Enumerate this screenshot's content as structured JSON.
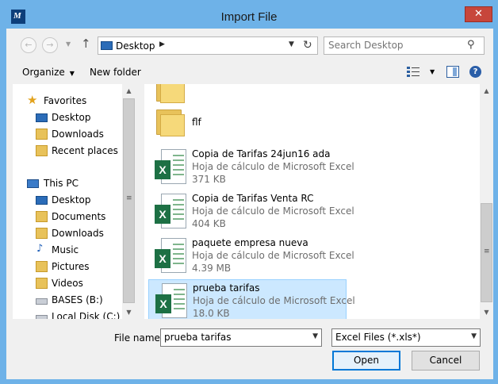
{
  "window": {
    "title": "Import File",
    "close_glyph": "✕",
    "icon": "dynamics-app-icon"
  },
  "address_bar": {
    "location": "Desktop"
  },
  "search": {
    "placeholder": "Search Desktop"
  },
  "toolbar": {
    "organize_label": "Organize",
    "new_folder_label": "New folder"
  },
  "nav_pane": {
    "favorites_header": "Favorites",
    "favorites": [
      {
        "label": "Desktop",
        "icon": "desktop-icon"
      },
      {
        "label": "Downloads",
        "icon": "downloads-folder-icon"
      },
      {
        "label": "Recent places",
        "icon": "recent-places-icon"
      }
    ],
    "this_pc_header": "This PC",
    "this_pc": [
      {
        "label": "Desktop",
        "icon": "desktop-icon"
      },
      {
        "label": "Documents",
        "icon": "documents-folder-icon"
      },
      {
        "label": "Downloads",
        "icon": "downloads-folder-icon"
      },
      {
        "label": "Music",
        "icon": "music-icon"
      },
      {
        "label": "Pictures",
        "icon": "pictures-folder-icon"
      },
      {
        "label": "Videos",
        "icon": "videos-folder-icon"
      },
      {
        "label": "BASES (B:)",
        "icon": "drive-icon"
      },
      {
        "label": "Local Disk (C:)",
        "icon": "drive-icon"
      }
    ]
  },
  "files": [
    {
      "name": "flf",
      "kind": "folder"
    },
    {
      "name": "Copia de Tarifas 24jun16 ada",
      "type": "Hoja de cálculo de Microsoft Excel",
      "size": "371 KB",
      "kind": "excel"
    },
    {
      "name": "Copia de Tarifas Venta RC",
      "type": "Hoja de cálculo de Microsoft Excel",
      "size": "404 KB",
      "kind": "excel"
    },
    {
      "name": "paquete empresa nueva",
      "type": "Hoja de cálculo de Microsoft Excel",
      "size": "4.39 MB",
      "kind": "excel"
    },
    {
      "name": "prueba tarifas",
      "type": "Hoja de cálculo de Microsoft Excel",
      "size": "18.0 KB",
      "kind": "excel",
      "selected": true
    }
  ],
  "bottom": {
    "file_name_label": "File name:",
    "file_name_value": "prueba tarifas",
    "file_type_value": "Excel Files (*.xls*)",
    "open_label": "Open",
    "cancel_label": "Cancel"
  },
  "colors": {
    "titlebar": "#6eb2e8",
    "close": "#c7463b",
    "selection": "#cce8ff",
    "excel": "#1d7044"
  }
}
